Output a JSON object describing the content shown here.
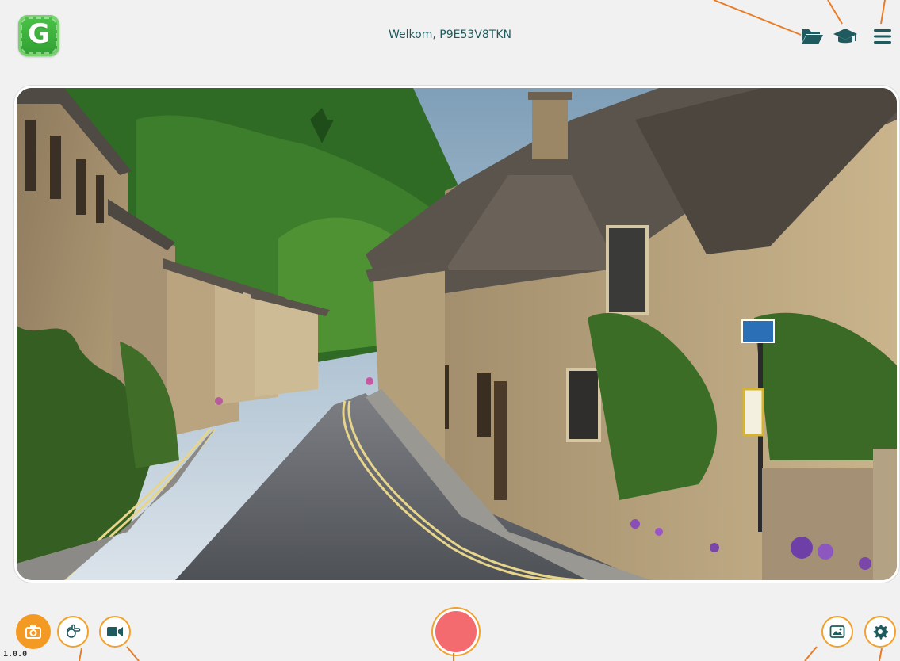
{
  "header": {
    "logo_letter": "G",
    "welcome_text": "Welkom, P9E53V8TKN"
  },
  "icons": {
    "folder": "folder-open-icon",
    "graduation": "graduation-cap-icon",
    "menu": "hamburger-menu-icon",
    "camera": "camera-icon",
    "gesture": "hand-gesture-icon",
    "video": "video-camera-icon",
    "gallery": "image-gallery-icon",
    "settings": "gear-icon"
  },
  "footer": {
    "version": "1.0.0"
  },
  "colors": {
    "accent_orange": "#f39a25",
    "teal_dark": "#1f5b5e",
    "record_red": "#f36a6f",
    "logo_green": "#3aab3a"
  }
}
